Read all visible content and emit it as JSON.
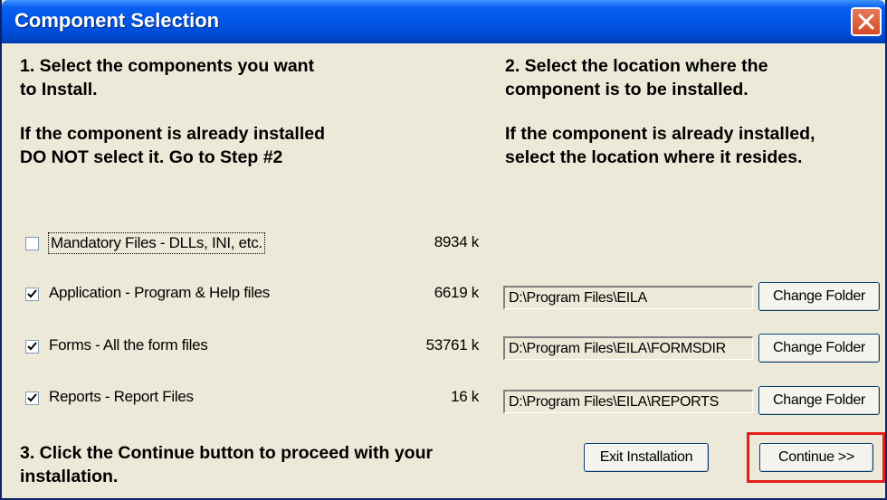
{
  "window": {
    "title": "Component Selection"
  },
  "step1": {
    "line1": "1.  Select the components you want",
    "line2": "to Install."
  },
  "warn1": {
    "line1": "If the component is already installed",
    "line2": "DO NOT select it.  Go to Step #2"
  },
  "step2": {
    "line1": "2.  Select the location where the",
    "line2": "component is to be installed."
  },
  "warn2": {
    "line1": "If the component is already installed,",
    "line2": "select the location where it resides."
  },
  "components": [
    {
      "label": "Mandatory Files - DLLs, INI, etc.",
      "size": "8934 k",
      "checked": false
    },
    {
      "label": "Application - Program & Help files",
      "size": "6619 k",
      "checked": true,
      "path": "D:\\Program Files\\EILA"
    },
    {
      "label": "Forms - All the form files",
      "size": "53761 k",
      "checked": true,
      "path": "D:\\Program Files\\EILA\\FORMSDIR"
    },
    {
      "label": "Reports - Report Files",
      "size": "16 k",
      "checked": true,
      "path": "D:\\Program Files\\EILA\\REPORTS"
    }
  ],
  "change_folder_label": "Change Folder",
  "step3": {
    "line1": "3.  Click the Continue button to proceed with your",
    "line2": "installation."
  },
  "buttons": {
    "exit": "Exit Installation",
    "continue": "Continue >>"
  },
  "highlight_color": "#e0201a"
}
